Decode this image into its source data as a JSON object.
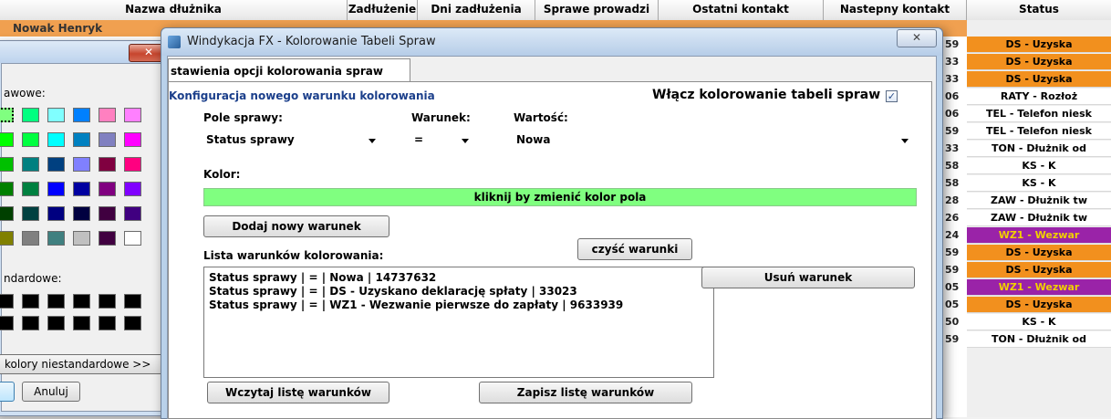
{
  "table": {
    "headers": [
      "Nazwa dłużnika",
      "Zadłużenie",
      "Dni zadłużenia",
      "Sprawe prowadzi",
      "Ostatni kontakt",
      "Nastepny kontakt",
      "Status"
    ],
    "first_row_name": "Nowak Henryk",
    "number_fragments": [
      "59",
      "33",
      "33",
      "06",
      "06",
      "59",
      "33",
      "58",
      "58",
      "28",
      "26",
      "24",
      "59",
      "59",
      "05",
      "05",
      "50",
      "59"
    ],
    "status_rows": [
      {
        "text": "DS - Uzyska",
        "bg": "#f2901e",
        "fg": "#000000"
      },
      {
        "text": "DS - Uzyska",
        "bg": "#f2901e",
        "fg": "#000000"
      },
      {
        "text": "DS - Uzyska",
        "bg": "#f2901e",
        "fg": "#000000"
      },
      {
        "text": "RATY - Rozłoż",
        "bg": "#ffffff",
        "fg": "#000000"
      },
      {
        "text": "TEL - Telefon niesk",
        "bg": "#ffffff",
        "fg": "#000000"
      },
      {
        "text": "TEL - Telefon niesk",
        "bg": "#ffffff",
        "fg": "#000000"
      },
      {
        "text": "TON - Dłużnik od",
        "bg": "#ffffff",
        "fg": "#000000"
      },
      {
        "text": "KS - K",
        "bg": "#ffffff",
        "fg": "#000000"
      },
      {
        "text": "KS - K",
        "bg": "#ffffff",
        "fg": "#000000"
      },
      {
        "text": "ZAW - Dłużnik tw",
        "bg": "#ffffff",
        "fg": "#000000"
      },
      {
        "text": "ZAW - Dłużnik tw",
        "bg": "#ffffff",
        "fg": "#000000"
      },
      {
        "text": "WZ1 - Wezwar",
        "bg": "#9a23a8",
        "fg": "#f0d000"
      },
      {
        "text": "DS - Uzyska",
        "bg": "#f2901e",
        "fg": "#000000"
      },
      {
        "text": "DS - Uzyska",
        "bg": "#f2901e",
        "fg": "#000000"
      },
      {
        "text": "WZ1 - Wezwar",
        "bg": "#9a23a8",
        "fg": "#f0d000"
      },
      {
        "text": "DS - Uzyska",
        "bg": "#f2901e",
        "fg": "#000000"
      },
      {
        "text": "KS - K",
        "bg": "#ffffff",
        "fg": "#000000"
      },
      {
        "text": "TON - Dłużnik od",
        "bg": "#ffffff",
        "fg": "#000000"
      }
    ]
  },
  "color_dialog": {
    "basic_label": "awowe:",
    "custom_label": "ndardowe:",
    "define_button": "kolory niestandardowe >>",
    "cancel_button": "Anuluj",
    "close_symbol": "✕",
    "basic_colors": [
      "#80ff80",
      "#00ff80",
      "#80ffff",
      "#0080ff",
      "#ff80c0",
      "#ff80ff",
      "#00ff00",
      "#00ff40",
      "#00ffff",
      "#0080c0",
      "#8080c0",
      "#ff00ff",
      "#00c000",
      "#008080",
      "#004080",
      "#8080ff",
      "#800040",
      "#ff0080",
      "#008000",
      "#008040",
      "#0000ff",
      "#0000a0",
      "#800080",
      "#8000ff",
      "#004000",
      "#004040",
      "#000080",
      "#000040",
      "#400040",
      "#400080",
      "#808000",
      "#808080",
      "#408080",
      "#c0c0c0",
      "#400040",
      "#ffffff"
    ],
    "custom_colors": [
      "#000000",
      "#000000",
      "#000000",
      "#000000",
      "#000000",
      "#000000",
      "#000000",
      "#000000",
      "#000000",
      "#000000",
      "#000000",
      "#000000"
    ]
  },
  "main_dialog": {
    "title": "Windykacja FX - Kolorowanie Tabeli Spraw",
    "close_symbol": "✕",
    "tab_label": "stawienia opcji kolorowania spraw",
    "section_heading": "Konfiguracja nowego warunku kolorowania",
    "enable_label": "Włącz kolorowanie tabeli spraw",
    "enable_checked": true,
    "check_symbol": "✓",
    "field_label": "Pole sprawy:",
    "field_value": "Status sprawy",
    "condition_label": "Warunek:",
    "condition_value": "=",
    "value_label": "Wartość:",
    "value_value": "Nowa",
    "color_label": "Kolor:",
    "color_bar_text": "kliknij by zmienić kolor pola",
    "color_bar_color": "#80ff80",
    "add_button": "Dodaj nowy warunek",
    "clear_button": "czyść warunki",
    "list_label": "Lista warunków kolorowania:",
    "conditions": [
      "Status sprawy | = | Nowa | 14737632",
      "Status sprawy | = | DS - Uzyskano deklarację spłaty | 33023",
      "Status sprawy | = | WZ1 - Wezwanie pierwsze do zapłaty | 9633939"
    ],
    "remove_button": "Usuń warunek",
    "load_button": "Wczytaj listę warunków",
    "save_button": "Zapisz listę warunków"
  }
}
